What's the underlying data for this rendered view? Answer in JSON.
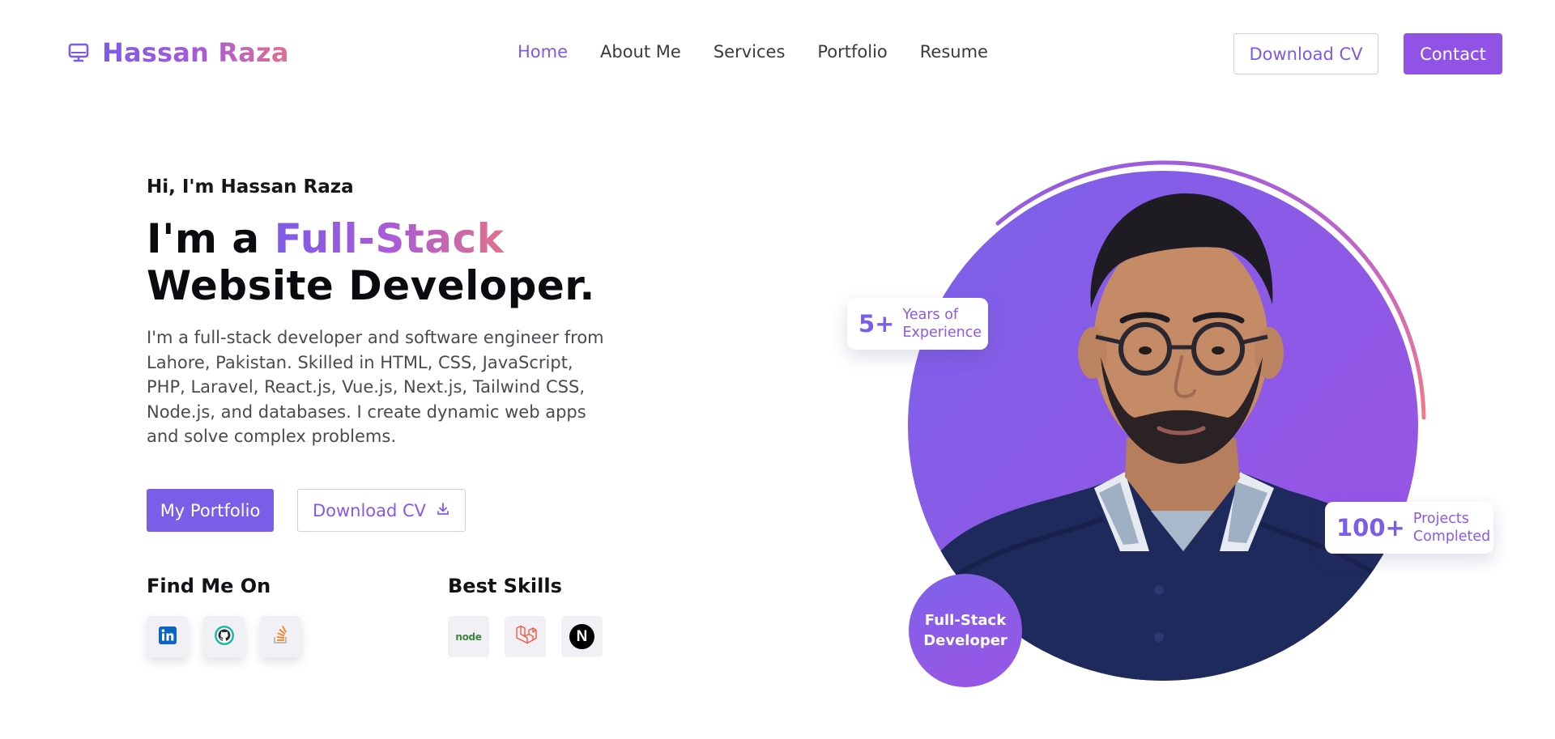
{
  "brand": {
    "name": "Hassan Raza",
    "icon": "monitor-icon"
  },
  "nav": {
    "items": [
      {
        "label": "Home",
        "active": true
      },
      {
        "label": "About Me",
        "active": false
      },
      {
        "label": "Services",
        "active": false
      },
      {
        "label": "Portfolio",
        "active": false
      },
      {
        "label": "Resume",
        "active": false
      }
    ]
  },
  "header_actions": {
    "download_cv": "Download CV",
    "contact": "Contact"
  },
  "hero": {
    "greeting": "Hi, I'm Hassan Raza",
    "headline_prefix": "I'm a ",
    "headline_highlight": "Full-Stack",
    "headline_line2": "Website Developer.",
    "description": "I'm a full-stack developer and software engineer from Lahore, Pakistan. Skilled in HTML, CSS, JavaScript, PHP, Laravel, React.js, Vue.js, Next.js, Tailwind CSS, Node.js, and databases. I create dynamic web apps and solve complex problems.",
    "primary_button": "My Portfolio",
    "secondary_button": "Download CV",
    "secondary_button_icon": "download-icon"
  },
  "find_me": {
    "title": "Find Me On",
    "links": [
      {
        "name": "linkedin",
        "icon": "linkedin-icon"
      },
      {
        "name": "github",
        "icon": "github-icon"
      },
      {
        "name": "stackoverflow",
        "icon": "stackoverflow-icon"
      }
    ]
  },
  "skills": {
    "title": "Best Skills",
    "items": [
      {
        "name": "node",
        "icon": "nodejs-icon",
        "text": "node"
      },
      {
        "name": "laravel",
        "icon": "laravel-icon"
      },
      {
        "name": "nextjs",
        "icon": "nextjs-icon",
        "text": "N"
      }
    ]
  },
  "stats": {
    "years": {
      "value": "5+",
      "label_line1": "Years of",
      "label_line2": "Experience"
    },
    "projects": {
      "value": "100+",
      "label_line1": "Projects",
      "label_line2": "Completed"
    }
  },
  "role_badge": {
    "line1": "Full-Stack",
    "line2": "Developer"
  },
  "colors": {
    "accent": "#7b5ee8",
    "accent_purple": "#9153e6",
    "gradient_pink": "#e0718c",
    "shirt_navy": "#1f2a5c"
  }
}
